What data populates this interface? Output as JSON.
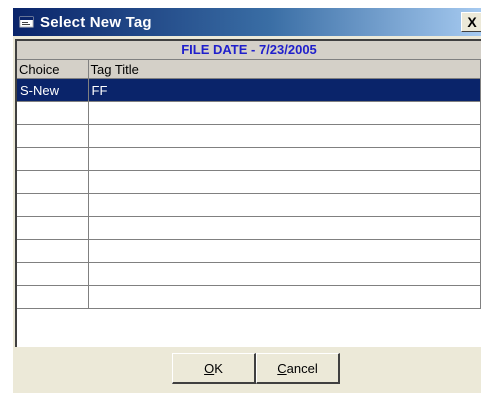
{
  "window": {
    "title": "Select New Tag",
    "close_label": "X"
  },
  "banner": {
    "text": "FILE DATE - 7/23/2005"
  },
  "grid": {
    "columns": [
      "Choice",
      "Tag Title"
    ],
    "rows": [
      {
        "choice": "S-New",
        "tag_title": "FF",
        "selected": true
      },
      {
        "choice": "",
        "tag_title": ""
      },
      {
        "choice": "",
        "tag_title": ""
      },
      {
        "choice": "",
        "tag_title": ""
      },
      {
        "choice": "",
        "tag_title": ""
      },
      {
        "choice": "",
        "tag_title": ""
      },
      {
        "choice": "",
        "tag_title": ""
      },
      {
        "choice": "",
        "tag_title": ""
      },
      {
        "choice": "",
        "tag_title": ""
      },
      {
        "choice": "",
        "tag_title": ""
      }
    ]
  },
  "buttons": {
    "ok": {
      "mnemonic": "O",
      "rest": "K"
    },
    "cancel": {
      "mnemonic": "C",
      "rest": "ancel"
    }
  },
  "colors": {
    "banner_text": "#1f1fcc",
    "selection": "#0a246a"
  }
}
